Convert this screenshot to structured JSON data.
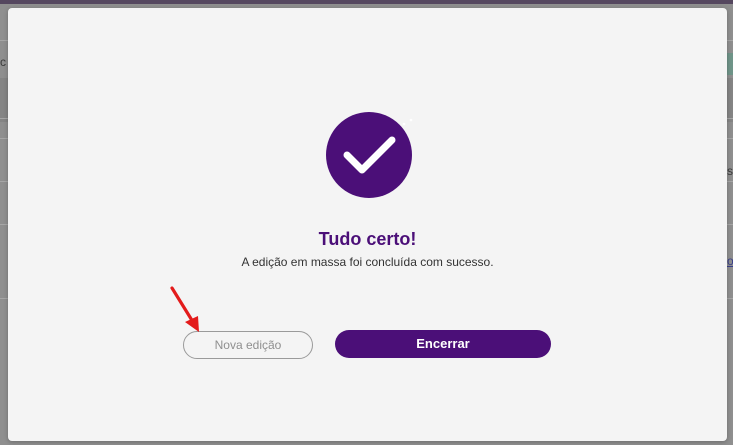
{
  "background": {
    "fragments": [
      {
        "text": "c"
      },
      {
        "text": "s"
      },
      {
        "text": "o"
      }
    ]
  },
  "modal": {
    "icon": "check-circle-icon",
    "title": "Tudo certo!",
    "message": "A edição em massa foi concluída com sucesso.",
    "buttons": {
      "secondary_label": "Nova edição",
      "primary_label": "Encerrar"
    }
  },
  "annotation": {
    "icon": "red-arrow-icon",
    "color": "#e31b1b"
  },
  "colors": {
    "brand_purple": "#4b0f78",
    "modal_bg": "#f4f4f4",
    "overlay": "#8f8f8f"
  }
}
